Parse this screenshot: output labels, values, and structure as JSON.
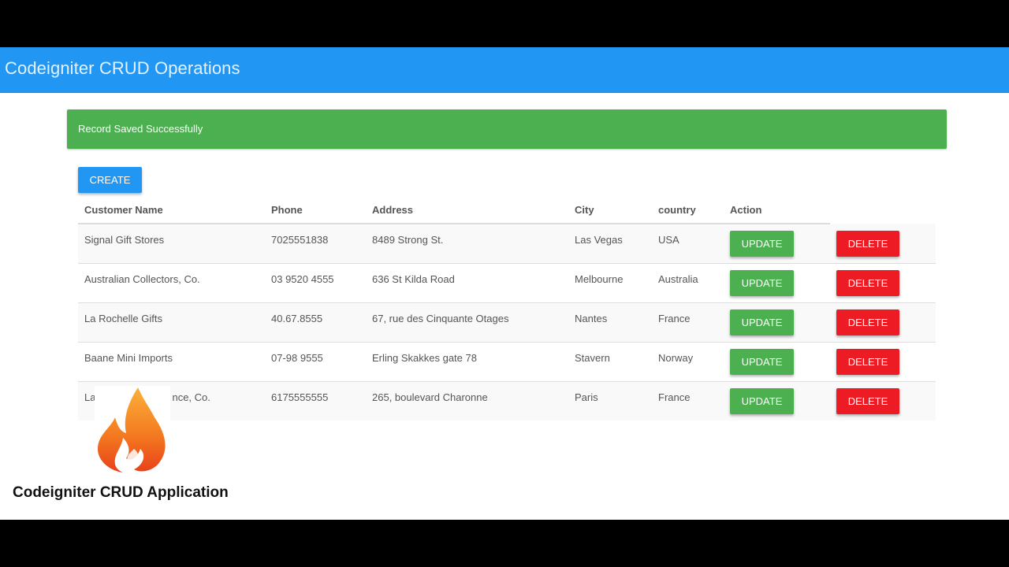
{
  "navbar": {
    "title": "Codeigniter CRUD Operations"
  },
  "alert": {
    "message": "Record Saved Successfully"
  },
  "toolbar": {
    "create_label": "CREATE"
  },
  "table": {
    "headers": [
      "Customer Name",
      "Phone",
      "Address",
      "City",
      "country",
      "Action"
    ],
    "rows": [
      {
        "name": "Signal Gift Stores",
        "phone": "7025551838",
        "address": "8489 Strong St.",
        "city": "Las Vegas",
        "country": "USA"
      },
      {
        "name": "Australian Collectors, Co.",
        "phone": "03 9520 4555",
        "address": "636 St Kilda Road",
        "city": "Melbourne",
        "country": "Australia"
      },
      {
        "name": "La Rochelle Gifts",
        "phone": "40.67.8555",
        "address": "67, rue des Cinquante Otages",
        "city": "Nantes",
        "country": "France"
      },
      {
        "name": "Baane Mini Imports",
        "phone": "07-98 9555",
        "address": "Erling Skakkes gate 78",
        "city": "Stavern",
        "country": "Norway"
      },
      {
        "name": "La",
        "name_tail": "nce, Co.",
        "phone": "6175555555",
        "address": "265, boulevard Charonne",
        "city": "Paris",
        "country": "France"
      }
    ],
    "update_label": "UPDATE",
    "delete_label": "DELETE"
  },
  "overlay": {
    "logo_icon": "codeigniter-flame-icon",
    "caption": "Codeigniter CRUD Application"
  },
  "colors": {
    "primary": "#2196f3",
    "success": "#4caf50",
    "danger": "#ed1c24"
  }
}
